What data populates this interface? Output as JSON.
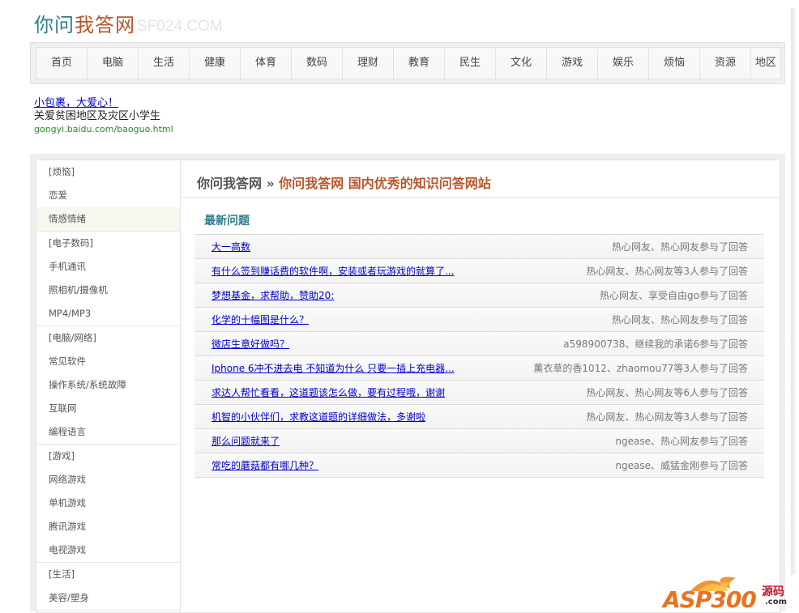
{
  "logo": {
    "part1": "你问",
    "part2": "我答网",
    "watermark": "SF024.COM"
  },
  "nav": [
    "首页",
    "电脑",
    "生活",
    "健康",
    "体育",
    "数码",
    "理财",
    "教育",
    "民生",
    "文化",
    "游戏",
    "娱乐",
    "烦恼",
    "资源",
    "地区"
  ],
  "ad": {
    "title": "小包裹，大爱心！",
    "desc": "关爱贫困地区及灾区小学生",
    "url": "gongyi.baidu.com/baoguo.html"
  },
  "sidebar": [
    {
      "head": "[烦恼]",
      "items": [
        "恋爱",
        "情感情绪"
      ]
    },
    {
      "head": "[电子数码]",
      "items": [
        "手机通讯",
        "照相机/摄像机",
        "MP4/MP3"
      ]
    },
    {
      "head": "[电脑/网络]",
      "items": [
        "常见软件",
        "操作系统/系统故障",
        "互联网",
        "编程语言"
      ]
    },
    {
      "head": "[游戏]",
      "items": [
        "网络游戏",
        "单机游戏",
        "腾讯游戏",
        "电视游戏"
      ]
    },
    {
      "head": "[生活]",
      "items": [
        "美容/塑身"
      ]
    }
  ],
  "breadcrumb": {
    "home": "你问我答网",
    "sep": " » ",
    "current": "你问我答网 国内优秀的知识问答网站"
  },
  "section_title": "最新问题",
  "questions": [
    {
      "title": "大一高数",
      "meta": "热心网友、热心网友参与了回答"
    },
    {
      "title": "有什么签到赚话费的软件啊，安装或者玩游戏的就算了...",
      "meta": "热心网友、热心网友等3人参与了回答"
    },
    {
      "title": "梦想基金，求帮助，赞助20:",
      "meta": "热心网友、享受自由go参与了回答"
    },
    {
      "title": "化学的十幅图是什么？",
      "meta": "热心网友、热心网友参与了回答"
    },
    {
      "title": "微店生意好做吗？",
      "meta": "a598900738、继续我的承诺6参与了回答"
    },
    {
      "title": "Iphone 6冲不进去电 不知道为什么 只要一插上充电器...",
      "meta": "薰衣草的香1012、zhaomou77等3人参与了回答"
    },
    {
      "title": "求达人帮忙看看，这道题该怎么做，要有过程哦，谢谢",
      "meta": "热心网友、热心网友等6人参与了回答"
    },
    {
      "title": "机智的小伙伴们，求教这道题的详细做法，多谢啦",
      "meta": "热心网友、热心网友等3人参与了回答"
    },
    {
      "title": "那么问题就来了",
      "meta": "ngease、热心网友参与了回答"
    },
    {
      "title": "常吃的蘑菇都有哪几种？",
      "meta": "ngease、威猛金刚参与了回答"
    }
  ],
  "brand": {
    "main": "ASP300",
    "side": "源码",
    "domain": ".com"
  }
}
